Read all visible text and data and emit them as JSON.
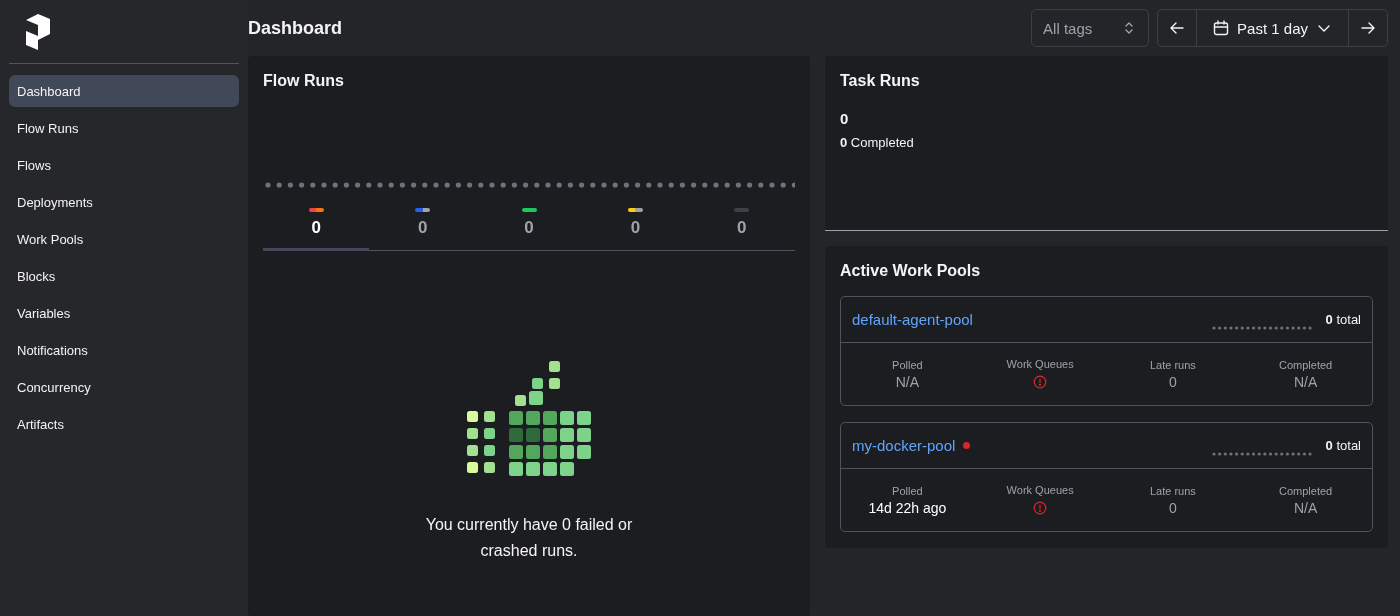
{
  "sidebar": {
    "items": [
      {
        "label": "Dashboard",
        "selected": true
      },
      {
        "label": "Flow Runs",
        "selected": false
      },
      {
        "label": "Flows",
        "selected": false
      },
      {
        "label": "Deployments",
        "selected": false
      },
      {
        "label": "Work Pools",
        "selected": false
      },
      {
        "label": "Blocks",
        "selected": false
      },
      {
        "label": "Variables",
        "selected": false
      },
      {
        "label": "Notifications",
        "selected": false
      },
      {
        "label": "Concurrency",
        "selected": false
      },
      {
        "label": "Artifacts",
        "selected": false
      }
    ]
  },
  "header": {
    "title": "Dashboard",
    "tags_select": {
      "placeholder": "All tags"
    },
    "date_range": "Past 1 day"
  },
  "flow_runs": {
    "title": "Flow Runs",
    "states": [
      {
        "count": "0",
        "selected": true,
        "segments": [
          {
            "color": "#ef4444"
          },
          {
            "color": "#f97316"
          }
        ]
      },
      {
        "count": "0",
        "selected": false,
        "segments": [
          {
            "color": "#2563eb"
          },
          {
            "color": "#a1a1aa"
          }
        ]
      },
      {
        "count": "0",
        "selected": false,
        "segments": [
          {
            "color": "#22c55e"
          }
        ]
      },
      {
        "count": "0",
        "selected": false,
        "segments": [
          {
            "color": "#facc15"
          },
          {
            "color": "#a1a1aa"
          }
        ]
      },
      {
        "count": "0",
        "selected": false,
        "segments": [
          {
            "color": "#3f3f46"
          }
        ]
      }
    ],
    "empty_message": "You currently have 0 failed or crashed runs."
  },
  "task_runs": {
    "title": "Task Runs",
    "total": "0",
    "completed": "**0** Completed"
  },
  "work_pools": {
    "title": "Active Work Pools",
    "pools": [
      {
        "name": "default-agent-pool",
        "alert": false,
        "total": "**0** total",
        "stats": [
          {
            "label": "Polled",
            "kind": "text",
            "value": "N/A",
            "muted": true
          },
          {
            "label": "Work Queues",
            "kind": "warning"
          },
          {
            "label": "Late runs",
            "kind": "text",
            "value": "0",
            "muted": true
          },
          {
            "label": "Completed",
            "kind": "text",
            "value": "N/A",
            "muted": true
          }
        ]
      },
      {
        "name": "my-docker-pool",
        "alert": true,
        "total": "**0** total",
        "stats": [
          {
            "label": "Polled",
            "kind": "text",
            "value": "14d 22h ago",
            "muted": false
          },
          {
            "label": "Work Queues",
            "kind": "warning"
          },
          {
            "label": "Late runs",
            "kind": "text",
            "value": "0",
            "muted": true
          },
          {
            "label": "Completed",
            "kind": "text",
            "value": "N/A",
            "muted": true
          }
        ]
      }
    ]
  }
}
